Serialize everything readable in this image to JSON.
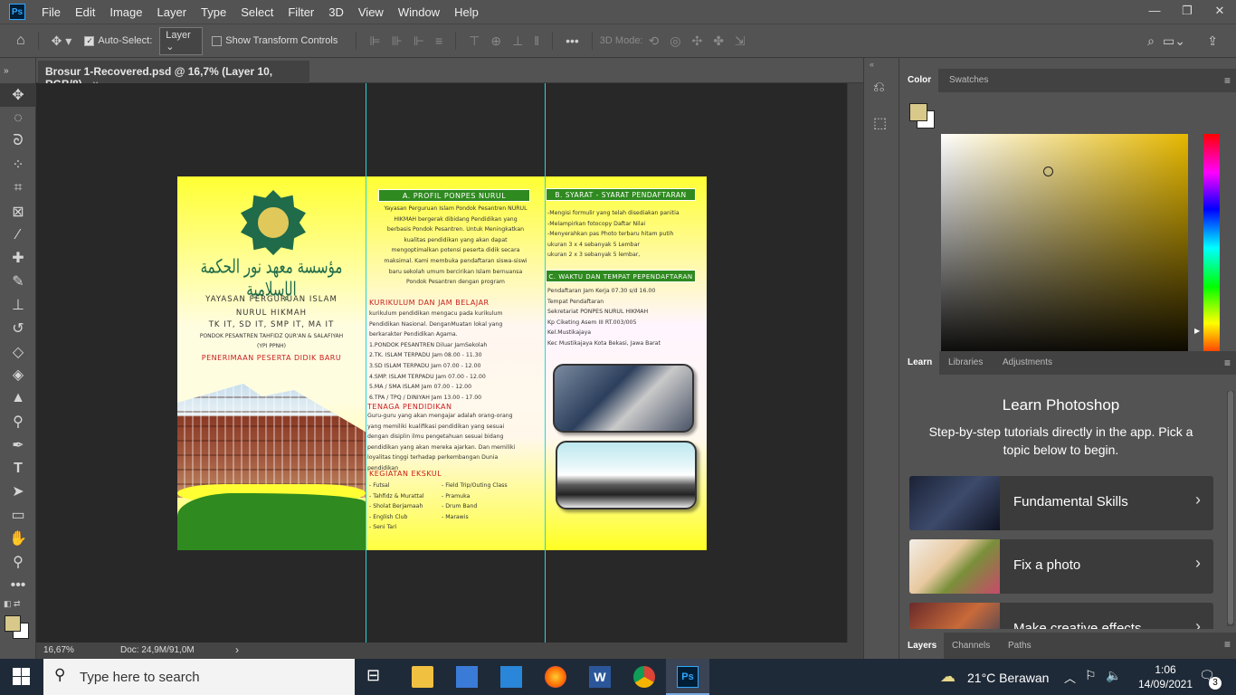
{
  "menubar": {
    "app_icon": "Ps",
    "items": [
      "File",
      "Edit",
      "Image",
      "Layer",
      "Type",
      "Select",
      "Filter",
      "3D",
      "View",
      "Window",
      "Help"
    ],
    "window_controls": [
      "—",
      "❐",
      "✕"
    ]
  },
  "options": {
    "auto_select_label": "Auto-Select:",
    "auto_select_value": "Layer",
    "show_transform_label": "Show Transform Controls",
    "mode_3d_label": "3D Mode:"
  },
  "document": {
    "tab_title": "Brosur 1-Recovered.psd @ 16,7% (Layer 10, RGB/8)",
    "close": "×"
  },
  "status": {
    "zoom": "16,67%",
    "doc": "Doc: 24,9M/91,0M",
    "arrow": "›"
  },
  "brochure": {
    "p1": {
      "arabic": "مؤسسة معهد نور الحكمة الإسلامية",
      "line1": "YAYASAN PERGURUAN ISLAM",
      "line2": "NURUL HIKMAH",
      "line3": "TK IT, SD IT, SMP IT, MA IT",
      "line4": "PONDOK PESANTREN TAHFIDZ QUR'AN & SALAFIYAH",
      "line5": "(YPI PPNH)",
      "line6": "PENERIMAAN PESERTA DIDIK BARU"
    },
    "p2": {
      "hdr_a": "A. PROFIL PONPES NURUL",
      "profil": [
        "Yayasan Perguruan Islam Pondok Pesantren NURUL",
        "HIKMAH bergerak dibidang Pendidikan yang",
        "berbasis Pondok Pesantren. Untuk Meningkatkan",
        "kualitas pendidikan yang akan dapat",
        "mengoptimalkan potensi peserta didik secara",
        "maksimal. Kami membuka pendaftaran siswa-siswi",
        "baru sekolah umum bercirikan Islam bernuansa",
        "Pondok Pesantren dengan program"
      ],
      "hdr_kurikulum": "KURIKULUM DAN JAM BELAJAR",
      "kurikulum": [
        "kurikulum pendidikan mengacu pada kurikulum",
        "Pendidikan Nasional. DenganMuatan lokal yang",
        "berkarakter Pendidikan Agama.",
        "1.PONDOK PESANTREN    Diluar JamSekolah",
        "2.TK. ISLAM TERPADU     Jam 08.00 - 11.30",
        "3.SD ISLAM TERPADU      Jam 07.00 - 12.00",
        "4.SMP. ISLAM TERPADU    Jam 07.00 - 12.00",
        "5.MA / SMA ISLAM           Jam 07.00 - 12.00",
        "6.TPA / TPQ / DINIYAH     Jam 13.00 - 17.00"
      ],
      "hdr_tenaga": "TENAGA PENDIDIKAN",
      "tenaga": [
        "Guru-guru yang akan mengajar adalah orang-orang",
        "yang memiliki kualifikasi pendidikan yang sesuai",
        "dengan disiplin ilmu pengetahuan sesuai bidang",
        "pendidikan yang akan mereka ajarkan. Dan memiliki",
        "loyalitas tinggi terhadap perkembangan Dunia",
        "pendidikan"
      ],
      "hdr_ekskul": "KEGIATAN EKSKUL",
      "ekskul_left": [
        "- Futsal",
        "- Tahfidz & Murattal",
        "- Sholat Berjamaah",
        "- English Club",
        "- Seni Tari"
      ],
      "ekskul_right": [
        "- Field Trip/Outing Class",
        "- Pramuka",
        "- Drum Band",
        "- Marawis"
      ]
    },
    "p3": {
      "hdr_b": "B. SYARAT - SYARAT PENDAFTARAN",
      "syarat": [
        "-Mengisi formulir yang telah disediakan panitia",
        "-Melampirkan fotocopy Daftar Nilai",
        "-Menyerahkan pas Photo terbaru hitam putih",
        "ukuran 3 x 4 sebanyak 5 Lembar",
        "ukuran 2 x 3 sebanyak 5 lembar,"
      ],
      "hdr_c": "C. WAKTU DAN TEMPAT PEPENDAFTARAN",
      "waktu": [
        "Pendaftaran Jam Kerja 07.30 s/d 16.00",
        "Tempat Pendaftaran",
        "Sekretariat PONPES NURUL HIKMAH",
        "Kp Ciketing Asem III RT.003/005",
        "Kel.Mustikajaya",
        "Kec Mustikajaya Kota Bekasi, Jawa Barat"
      ]
    }
  },
  "color_panel": {
    "tabs": [
      "Color",
      "Swatches"
    ],
    "foreground": "#d8c98a",
    "background": "#ffffff",
    "hue_accent": "#e6b800"
  },
  "learn_panel": {
    "tabs": [
      "Learn",
      "Libraries",
      "Adjustments"
    ],
    "title": "Learn Photoshop",
    "subtitle": "Step-by-step tutorials directly in the app. Pick a topic below to begin.",
    "cards": [
      "Fundamental Skills",
      "Fix a photo",
      "Make creative effects"
    ]
  },
  "layers_panel": {
    "tabs": [
      "Layers",
      "Channels",
      "Paths"
    ]
  },
  "taskbar": {
    "search_placeholder": "Type here to search",
    "weather": "21°C  Berawan",
    "time": "1:06",
    "date": "14/09/2021",
    "notifications": "3"
  }
}
